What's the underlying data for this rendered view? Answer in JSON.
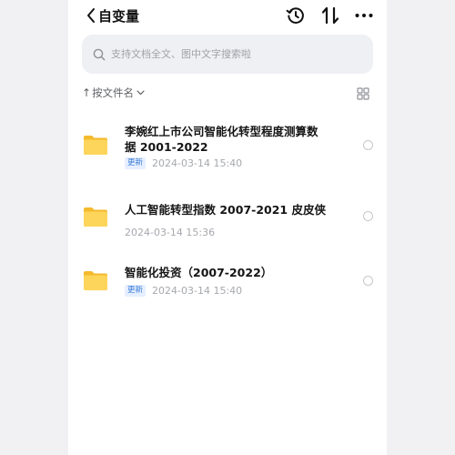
{
  "header": {
    "title": "自变量",
    "back_icon": "chevron-left-icon",
    "history_icon": "history-icon",
    "sort_icon": "swap-vertical-icon",
    "more_icon": "more-icon"
  },
  "search": {
    "placeholder": "支持文档全文、图中文字搜索啦",
    "value": ""
  },
  "sortbar": {
    "arrow": "↑",
    "label": "按文件名",
    "chevron_icon": "chevron-down-icon",
    "view_icon": "grid-view-icon"
  },
  "files": [
    {
      "name_line1": "李婉红上市公司智能化转型程度测算数",
      "name_line2": "据 2001-2022",
      "badge": "更新",
      "date": "2024-03-14 15:40",
      "icon": "folder-icon"
    },
    {
      "name_line1": "人工智能转型指数 2007-2021 皮皮侠",
      "badge": "",
      "date": "2024-03-14 15:36",
      "icon": "folder-icon"
    },
    {
      "name_line1": "智能化投资（2007-2022）",
      "badge": "更新",
      "date": "2024-03-14 15:40",
      "icon": "folder-icon"
    }
  ],
  "colors": {
    "folder": "#f7c948",
    "badge_text": "#3a7bd5",
    "badge_bg": "#e6efff",
    "search_bg": "#eff0f4"
  }
}
